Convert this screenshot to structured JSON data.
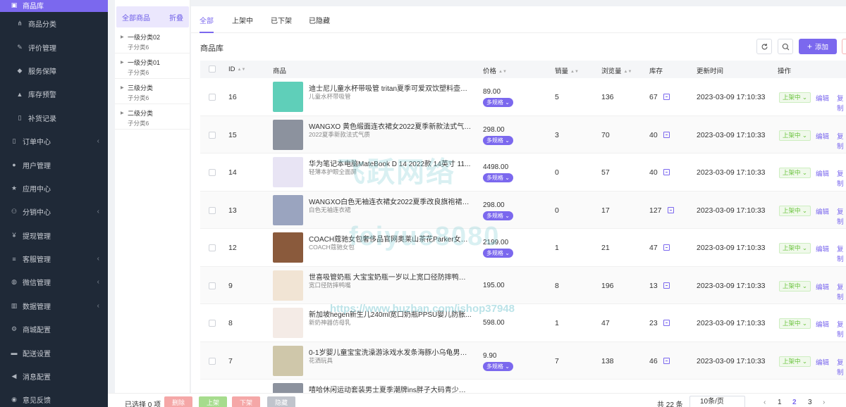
{
  "nav": {
    "items": [
      {
        "label": "商品库",
        "icon": "box-icon",
        "active": true,
        "sub": false
      },
      {
        "label": "商品分类",
        "icon": "sitemap-icon",
        "sub": true
      },
      {
        "label": "评价管理",
        "icon": "edit-icon",
        "sub": true
      },
      {
        "label": "服务保障",
        "icon": "tag-icon",
        "sub": true
      },
      {
        "label": "库存预警",
        "icon": "warning-icon",
        "sub": true
      },
      {
        "label": "补货记录",
        "icon": "file-icon",
        "sub": true
      },
      {
        "label": "订单中心",
        "icon": "file-icon",
        "arrow": true
      },
      {
        "label": "用户管理",
        "icon": "user-icon"
      },
      {
        "label": "应用中心",
        "icon": "star-icon"
      },
      {
        "label": "分销中心",
        "icon": "users-icon",
        "arrow": true
      },
      {
        "label": "提现管理",
        "icon": "yen-icon"
      },
      {
        "label": "客服管理",
        "icon": "list-icon",
        "arrow": true
      },
      {
        "label": "微信管理",
        "icon": "wechat-icon",
        "arrow": true
      },
      {
        "label": "数据管理",
        "icon": "chart-icon",
        "arrow": true
      },
      {
        "label": "商城配置",
        "icon": "gears-icon"
      },
      {
        "label": "配送设置",
        "icon": "car-icon"
      },
      {
        "label": "消息配置",
        "icon": "bullhorn-icon"
      },
      {
        "label": "意见反馈",
        "icon": "comment-icon"
      }
    ]
  },
  "category": {
    "title": "全部商品",
    "fold_label": "折叠",
    "groups": [
      {
        "name": "一级分类02",
        "child": "子分类6"
      },
      {
        "name": "一级分类01",
        "child": "子分类6"
      },
      {
        "name": "三级分类",
        "child": "子分类6"
      },
      {
        "name": "二级分类",
        "child": "子分类6"
      }
    ]
  },
  "tabs": [
    "全部",
    "上架中",
    "已下架",
    "已隐藏"
  ],
  "page_title": "商品库",
  "add_label": "添加",
  "table": {
    "headers": {
      "id": "ID",
      "product": "商品",
      "price": "价格",
      "sales": "销量",
      "views": "浏览量",
      "stock": "库存",
      "updated": "更新时间",
      "actions": "操作"
    },
    "rows": [
      {
        "id": "16",
        "name": "迪士尼儿童水杯带吸管 tritan夏季可爱双饮塑料壶幼儿...",
        "sub": "儿童水杯带吸管",
        "price": "89.00",
        "spec": "多规格",
        "sales": "5",
        "views": "136",
        "stock": "67",
        "updated": "2023-03-09 17:10:33",
        "status": "上架中",
        "thumb": "#5fcfb9"
      },
      {
        "id": "15",
        "name": "WANGXO 黄色缎面连衣裙女2022夏季新款法式气质...",
        "sub": "2022夏季新款法式气质",
        "price": "298.00",
        "spec": "多规格",
        "sales": "3",
        "views": "70",
        "stock": "40",
        "updated": "2023-03-09 17:10:33",
        "status": "上架中",
        "thumb": "#8c929e"
      },
      {
        "id": "14",
        "name": "华为笔记本电脑MateBook D 14 2022款 14英寸 11...",
        "sub": "轻薄本护眼全面屏",
        "price": "4498.00",
        "spec": "多规格",
        "sales": "0",
        "views": "57",
        "stock": "40",
        "updated": "2023-03-09 17:10:33",
        "status": "上架中",
        "thumb": "#e8e4f4"
      },
      {
        "id": "13",
        "name": "WANGXO白色无袖连衣裙女2022夏季改良旗袍裙高...",
        "sub": "白色无袖连衣裙",
        "price": "298.00",
        "spec": "多规格",
        "sales": "0",
        "views": "17",
        "stock": "127",
        "updated": "2023-03-09 17:10:33",
        "status": "上架中",
        "thumb": "#9aa4bf"
      },
      {
        "id": "12",
        "name": "COACH蔻驰女包奢侈品官网奥莱山茶花Parker女士单...",
        "sub": "COACH蔻驰女包",
        "price": "2199.00",
        "spec": "多规格",
        "sales": "1",
        "views": "21",
        "stock": "47",
        "updated": "2023-03-09 17:10:33",
        "status": "上架中",
        "thumb": "#8a5a3c"
      },
      {
        "id": "9",
        "name": "世喜吸管奶瓶 大宝宝奶瓶一岁以上宽口径防摔鸭嘴杯...",
        "sub": "宽口径防摔鸭嘴",
        "price": "195.00",
        "spec": "",
        "sales": "8",
        "views": "196",
        "stock": "13",
        "updated": "2023-03-09 17:10:33",
        "status": "上架中",
        "thumb": "#f1e4d4"
      },
      {
        "id": "8",
        "name": "新加坡hegen新生儿240ml宽口奶瓶PPSU婴儿防胀...",
        "sub": "新奶神器仿母乳",
        "price": "598.00",
        "spec": "",
        "sales": "1",
        "views": "47",
        "stock": "23",
        "updated": "2023-03-09 17:10:33",
        "status": "上架中",
        "thumb": "#f4ebe6"
      },
      {
        "id": "7",
        "name": "0-1岁婴儿童宝宝洗澡游泳戏水发条海豚小乌龟男女孩...",
        "sub": "花洒玩具",
        "price": "9.90",
        "spec": "多规格",
        "sales": "7",
        "views": "138",
        "stock": "46",
        "updated": "2023-03-09 17:10:33",
        "status": "上架中",
        "thumb": "#cfc7aa"
      }
    ],
    "partial_row": {
      "name": "嘻哈休闲运动套装男士夏季潮牌ins胖子大码青少年男...",
      "thumb": "#8c929e"
    },
    "edit_label": "编辑",
    "copy_label": "复制"
  },
  "footer": {
    "selected": "已选择 0 项",
    "buttons": [
      {
        "label": "删除",
        "color": "#f5a7a7"
      },
      {
        "label": "上架",
        "color": "#a6dc8d"
      },
      {
        "label": "下架",
        "color": "#f5a7a7"
      },
      {
        "label": "隐藏",
        "color": "#c0c4cc"
      }
    ],
    "total": "共 22 条",
    "page_size": "10条/页",
    "prev": "‹",
    "pages": [
      "1",
      "2",
      "3"
    ],
    "current_page": "2",
    "next": "›"
  },
  "watermarks": {
    "line1": "飞跃网络",
    "line2": "feiyue8080",
    "line3": "https://www.huzhan.com/ishop37948"
  }
}
